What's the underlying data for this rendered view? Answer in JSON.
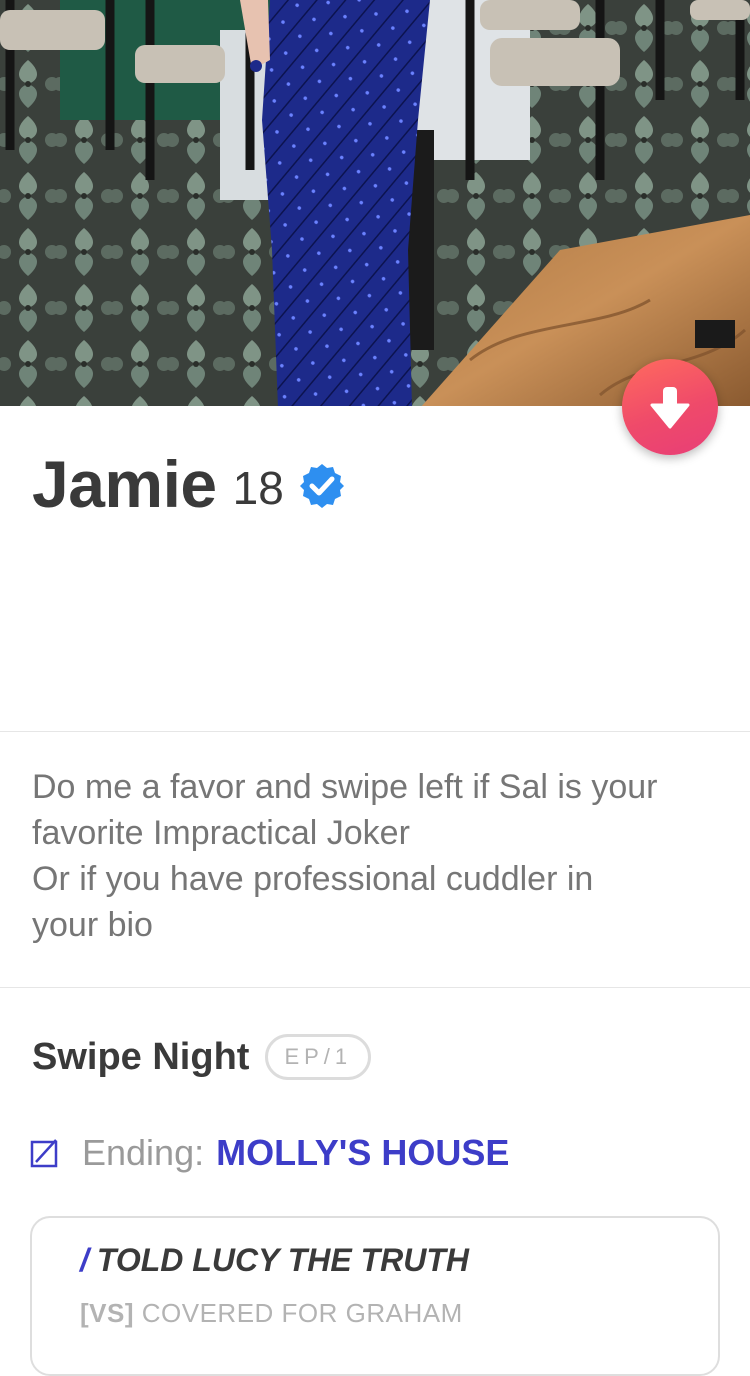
{
  "profile": {
    "name": "Jamie",
    "age": "18",
    "verified": true
  },
  "bio": {
    "lines": [
      "Do me a favor and swipe left if Sal is your",
      "favorite Impractical Joker",
      "Or if you have professional cuddler in",
      "your bio"
    ]
  },
  "swipe_night": {
    "title": "Swipe Night",
    "episode": "EP/1",
    "ending_label": "Ending:",
    "ending_value": "MOLLY'S HOUSE",
    "choice_main": "TOLD LUCY THE TRUTH",
    "choice_slash": "/",
    "choice_alt_tag": "[VS]",
    "choice_alt": "COVERED FOR GRAHAM"
  },
  "icons": {
    "collapse": "arrow-down-icon",
    "verified": "verified-badge-icon",
    "ending": "edit-square-icon"
  },
  "colors": {
    "accent_gradient_start": "#ff6b5e",
    "accent_gradient_end": "#e83e77",
    "verified_blue": "#2e8ff0",
    "swipe_night_blue": "#3d3dc8"
  }
}
